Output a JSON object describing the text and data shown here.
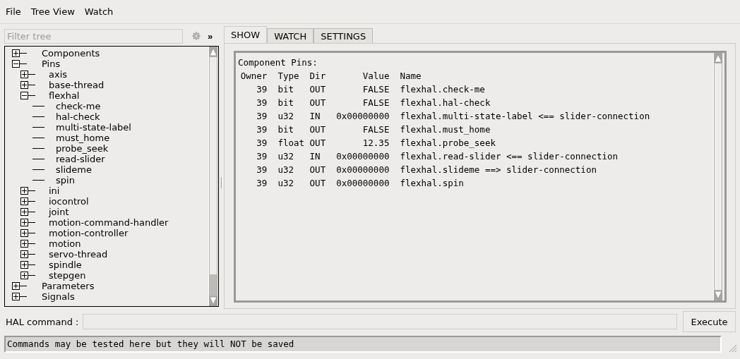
{
  "menu": [
    "File",
    "Tree View",
    "Watch"
  ],
  "filter": {
    "placeholder": "Filter tree"
  },
  "expand_button": "»",
  "tree": [
    {
      "label": "Components",
      "expanded": false
    },
    {
      "label": "Pins",
      "expanded": true,
      "children": [
        {
          "label": "axis",
          "expanded": false
        },
        {
          "label": "base-thread",
          "expanded": false
        },
        {
          "label": "flexhal",
          "expanded": true,
          "children": [
            {
              "label": "check-me"
            },
            {
              "label": "hal-check"
            },
            {
              "label": "multi-state-label"
            },
            {
              "label": "must_home"
            },
            {
              "label": "probe_seek"
            },
            {
              "label": "read-slider"
            },
            {
              "label": "slideme"
            },
            {
              "label": "spin"
            }
          ]
        },
        {
          "label": "ini",
          "expanded": false
        },
        {
          "label": "iocontrol",
          "expanded": false
        },
        {
          "label": "joint",
          "expanded": false
        },
        {
          "label": "motion-command-handler",
          "expanded": false
        },
        {
          "label": "motion-controller",
          "expanded": false
        },
        {
          "label": "motion",
          "expanded": false
        },
        {
          "label": "servo-thread",
          "expanded": false
        },
        {
          "label": "spindle",
          "expanded": false
        },
        {
          "label": "stepgen",
          "expanded": false
        }
      ]
    },
    {
      "label": "Parameters",
      "expanded": false
    },
    {
      "label": "Signals",
      "expanded": false
    }
  ],
  "tabs": [
    {
      "label": "SHOW",
      "selected": true
    },
    {
      "label": "WATCH",
      "selected": false
    },
    {
      "label": "SETTINGS",
      "selected": false
    }
  ],
  "output": {
    "heading": "Component Pins:",
    "columns": [
      "Owner",
      "Type",
      "Dir",
      "Value",
      "Name"
    ],
    "rows": [
      [
        "39",
        "bit",
        "OUT",
        "FALSE",
        "flexhal.check-me"
      ],
      [
        "39",
        "bit",
        "OUT",
        "FALSE",
        "flexhal.hal-check"
      ],
      [
        "39",
        "u32",
        "IN",
        "0x00000000",
        "flexhal.multi-state-label <== slider-connection"
      ],
      [
        "39",
        "bit",
        "OUT",
        "FALSE",
        "flexhal.must_home"
      ],
      [
        "39",
        "float",
        "OUT",
        "12.35",
        "flexhal.probe_seek"
      ],
      [
        "39",
        "u32",
        "IN",
        "0x00000000",
        "flexhal.read-slider <== slider-connection"
      ],
      [
        "39",
        "u32",
        "OUT",
        "0x00000000",
        "flexhal.slideme ==> slider-connection"
      ],
      [
        "39",
        "u32",
        "OUT",
        "0x00000000",
        "flexhal.spin"
      ]
    ]
  },
  "command": {
    "label": "HAL command :",
    "button": "Execute"
  },
  "status_bar": "Commands may be tested here but they will NOT be saved"
}
